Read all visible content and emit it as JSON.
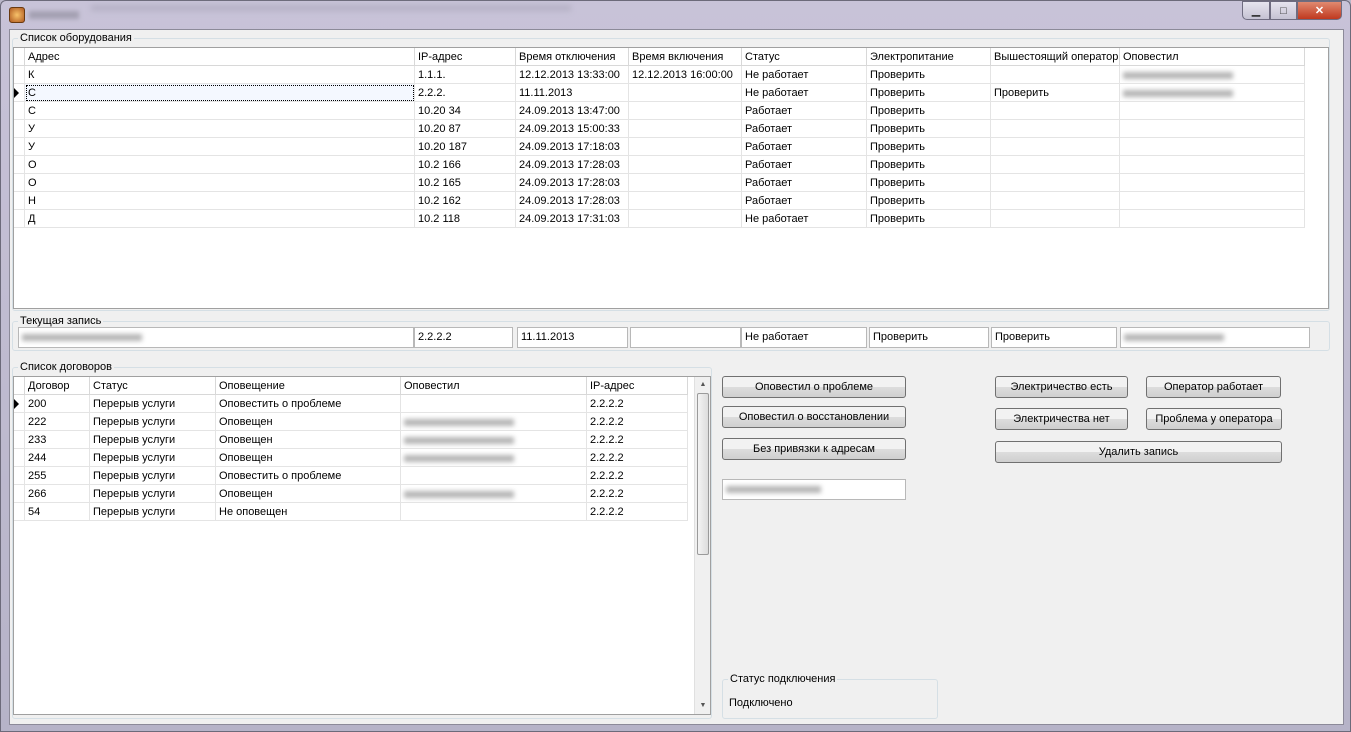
{
  "window": {
    "controls": {
      "minimize": "▁",
      "maximize": "□",
      "close": "✕"
    }
  },
  "equipment": {
    "title": "Список оборудования",
    "columns": [
      "Адрес",
      "IP-адрес",
      "Время отключения",
      "Время включения",
      "Статус",
      "Электропитание",
      "Вышестоящий оператор",
      "Оповестил"
    ],
    "rows": [
      [
        "К",
        "1.1.1.",
        "12.12.2013 13:33:00",
        "12.12.2013 16:00:00",
        "Не работает",
        "Проверить",
        "",
        ""
      ],
      [
        "С",
        "2.2.2.",
        "11.11.2013",
        "",
        "Не работает",
        "Проверить",
        "Проверить",
        ""
      ],
      [
        "С",
        "10.20   34",
        "24.09.2013 13:47:00",
        "",
        "Работает",
        "Проверить",
        "",
        ""
      ],
      [
        "У",
        "10.20   87",
        "24.09.2013 15:00:33",
        "",
        "Работает",
        "Проверить",
        "",
        ""
      ],
      [
        "У",
        "10.20   187",
        "24.09.2013 17:18:03",
        "",
        "Работает",
        "Проверить",
        "",
        ""
      ],
      [
        "О",
        "10.2    166",
        "24.09.2013 17:28:03",
        "",
        "Работает",
        "Проверить",
        "",
        ""
      ],
      [
        "О",
        "10.2    165",
        "24.09.2013 17:28:03",
        "",
        "Работает",
        "Проверить",
        "",
        ""
      ],
      [
        "Н",
        "10.2    162",
        "24.09.2013 17:28:03",
        "",
        "Работает",
        "Проверить",
        "",
        ""
      ],
      [
        "Д",
        "10.2    118",
        "24.09.2013 17:31:03",
        "",
        "Не работает",
        "Проверить",
        "",
        ""
      ]
    ],
    "blurred_notifier_rows": [
      0,
      1
    ],
    "selected_row": 1
  },
  "current": {
    "title": "Текущая запись",
    "ip": "2.2.2.2",
    "off_time": "11.11.2013",
    "on_time": "",
    "status": "Не работает",
    "power": "Проверить",
    "upstream": "Проверить"
  },
  "contracts": {
    "title": "Список договоров",
    "columns": [
      "Договор",
      "Статус",
      "Оповещение",
      "Оповестил",
      "IP-адрес"
    ],
    "rows": [
      [
        "200",
        "Перерыв услуги",
        "Оповестить о проблеме",
        "",
        "2.2.2.2"
      ],
      [
        "222",
        "Перерыв услуги",
        "Оповещен",
        "",
        "2.2.2.2"
      ],
      [
        "233",
        "Перерыв услуги",
        "Оповещен",
        "",
        "2.2.2.2"
      ],
      [
        "244",
        "Перерыв услуги",
        "Оповещен",
        "",
        "2.2.2.2"
      ],
      [
        "255",
        "Перерыв услуги",
        "Оповестить о проблеме",
        "",
        "2.2.2.2"
      ],
      [
        "266",
        "Перерыв услуги",
        "Оповещен",
        "",
        "2.2.2.2"
      ],
      [
        "54",
        "Перерыв услуги",
        "Не оповещен",
        "",
        "2.2.2.2"
      ]
    ],
    "blurred_notifier_rows": [
      1,
      2,
      3,
      5
    ],
    "selected_row": 0
  },
  "buttons": {
    "notified_problem": "Оповестил о проблеме",
    "notified_restore": "Оповестил о восстановлении",
    "no_address": "Без привязки к адресам",
    "power_on": "Электричество есть",
    "power_off": "Электричества нет",
    "operator_ok": "Оператор работает",
    "operator_problem": "Проблема у оператора",
    "delete": "Удалить запись"
  },
  "connection": {
    "title": "Статус подключения",
    "value": "Подключено"
  }
}
